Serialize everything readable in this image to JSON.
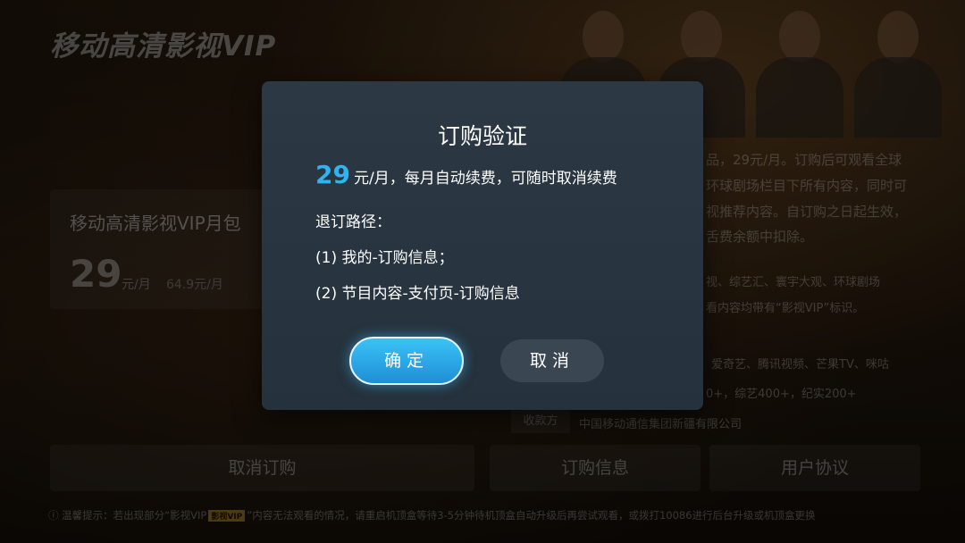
{
  "brand": "移动高清影视VIP",
  "package": {
    "title": "移动高清影视VIP月包",
    "price": "29",
    "unit": "元/月",
    "original_price": "64.9元/月"
  },
  "description_lines": [
    "品，29元/月。订购后可观看全球",
    "环球剧场栏目下所有内容，同时可",
    "视推荐内容。自订购之日起生效，",
    "舌费余额中扣除。",
    "视、综艺汇、寰宇大观、环球剧场",
    "看内容均带有“影视VIP”标识。",
    "爱奇艺、腾讯视频、芒果TV、咪咕",
    "0+，综艺400+，纪实200+"
  ],
  "payee": {
    "label": "收款方",
    "value": "中国移动通信集团新疆有限公司"
  },
  "bottom_buttons": {
    "unsubscribe": "取消订购",
    "order_info": "订购信息",
    "user_agreement": "用户协议"
  },
  "tip": {
    "prefix": "温馨提示：若出现部分“影视VIP",
    "badge": "影视VIP",
    "suffix": "”内容无法观看的情况，请重启机顶盒等待3-5分钟待机顶盒自动升级后再尝试观看，或拨打10086进行后台升级或机顶盒更换"
  },
  "dialog": {
    "title": "订购验证",
    "price": "29",
    "price_text": "元/月，每月自动续费，可随时取消续费",
    "route_label": "退订路径：",
    "route_1": "(1) 我的-订购信息；",
    "route_2": "(2) 节目内容-支付页-订购信息",
    "confirm": "确定",
    "cancel": "取消"
  }
}
